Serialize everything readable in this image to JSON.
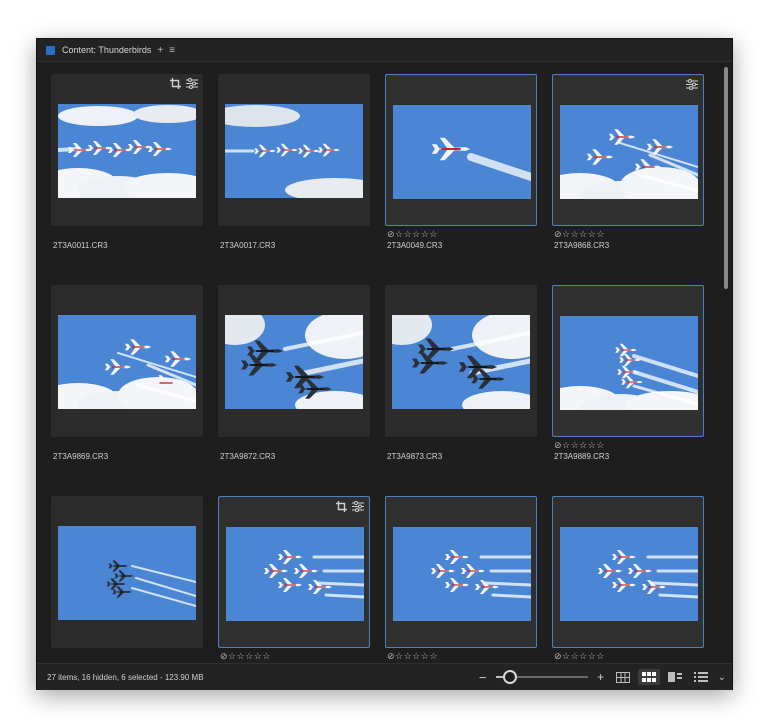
{
  "panel": {
    "title": "Content: Thunderbirds",
    "add_label": "+",
    "menu_label": "≡"
  },
  "items": [
    {
      "filename": "2T3A0011.CR3",
      "selected": false,
      "rating": "",
      "edit_icons": [
        "crop-icon",
        "adjustments-icon"
      ],
      "variant": "formation-left"
    },
    {
      "filename": "2T3A0017.CR3",
      "selected": false,
      "rating": "",
      "edit_icons": [],
      "variant": "formation-line"
    },
    {
      "filename": "2T3A0049.CR3",
      "selected": true,
      "rating": "⊘☆☆☆☆☆",
      "edit_icons": [],
      "variant": "single-jet"
    },
    {
      "filename": "2T3A9868.CR3",
      "selected": true,
      "rating": "⊘☆☆☆☆☆",
      "edit_icons": [
        "adjustments-icon"
      ],
      "variant": "four-jets-clouds"
    },
    {
      "filename": "2T3A9869.CR3",
      "selected": false,
      "rating": "",
      "edit_icons": [],
      "variant": "four-jets-clouds-2"
    },
    {
      "filename": "2T3A9872.CR3",
      "selected": false,
      "rating": "",
      "edit_icons": [],
      "variant": "dark-pair"
    },
    {
      "filename": "2T3A9873.CR3",
      "selected": false,
      "rating": "",
      "edit_icons": [],
      "variant": "dark-pair-2"
    },
    {
      "filename": "2T3A9889.CR3",
      "selected": true,
      "rating": "⊘☆☆☆☆☆",
      "edit_icons": [],
      "variant": "vertical-stack"
    },
    {
      "filename": "",
      "selected": false,
      "rating": "",
      "edit_icons": [],
      "variant": "diamond-small"
    },
    {
      "filename": "",
      "selected": true,
      "rating": "⊘☆☆☆☆☆",
      "edit_icons": [
        "crop-icon",
        "adjustments-icon"
      ],
      "variant": "diamond"
    },
    {
      "filename": "",
      "selected": true,
      "rating": "⊘☆☆☆☆☆",
      "edit_icons": [],
      "variant": "diamond"
    },
    {
      "filename": "",
      "selected": true,
      "rating": "⊘☆☆☆☆☆",
      "edit_icons": [],
      "variant": "diamond"
    }
  ],
  "status": {
    "summary": "27 items, 16 hidden, 6 selected - 123.90 MB",
    "zoom_minus": "−",
    "zoom_plus": "+",
    "zoom_level": 0.16
  },
  "colors": {
    "selection_border": "#4e7fc1",
    "sky": "#4a86d4",
    "panel_bg": "#1e1e1e"
  }
}
